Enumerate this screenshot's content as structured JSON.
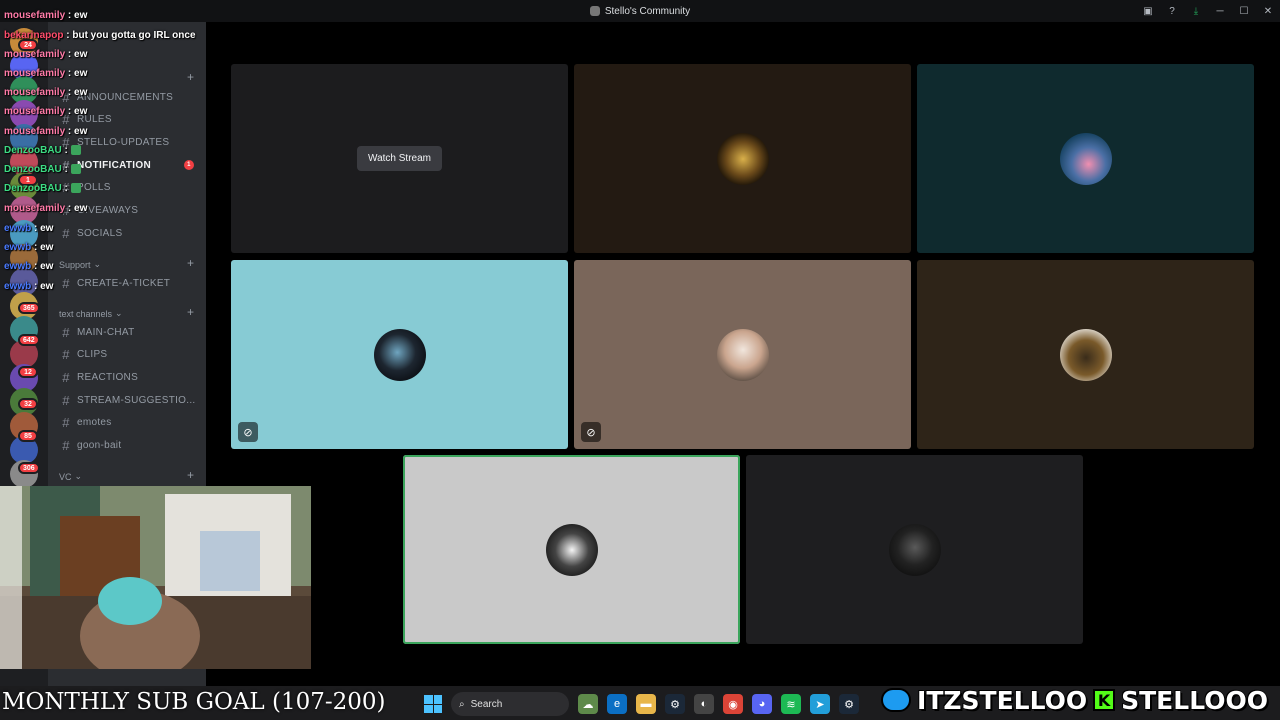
{
  "window": {
    "title": "Stello's Community"
  },
  "sidebar": {
    "channels_top": [
      {
        "name": "ANNOUNCEMENTS"
      },
      {
        "name": "RULES"
      },
      {
        "name": "STELLO-UPDATES"
      },
      {
        "name": "NOTIFICATION",
        "active": true,
        "unread": "1"
      },
      {
        "name": "POLLS"
      },
      {
        "name": "GIVEAWAYS"
      },
      {
        "name": "SOCIALS"
      }
    ],
    "support_category": "Support",
    "support_channels": [
      {
        "name": "CREATE-A-TICKET"
      }
    ],
    "text_category": "text channels",
    "text_channels": [
      {
        "name": "MAIN-CHAT"
      },
      {
        "name": "CLIPS"
      },
      {
        "name": "REACTIONS"
      },
      {
        "name": "STREAM-SUGGESTIO..."
      },
      {
        "name": "emotes"
      },
      {
        "name": "goon-bait"
      }
    ],
    "vc_category": "VC"
  },
  "rail_badges": [
    "24",
    "1",
    "365",
    "642",
    "12",
    "32",
    "85",
    "306"
  ],
  "stage": {
    "watch_stream": "Watch Stream"
  },
  "chat": {
    "messages": [
      {
        "user": "mousefamily",
        "text": "ew",
        "color": "#ff7ba8"
      },
      {
        "user": "bekarinapop",
        "text": "but you gotta go IRL once",
        "color": "#ff4d6d"
      },
      {
        "user": "mousefamily",
        "text": "ew",
        "color": "#ff7ba8"
      },
      {
        "user": "mousefamily",
        "text": "ew",
        "color": "#ff7ba8"
      },
      {
        "user": "mousefamily",
        "text": "ew",
        "color": "#ff7ba8"
      },
      {
        "user": "mousefamily",
        "text": "ew",
        "color": "#ff7ba8"
      },
      {
        "user": "mousefamily",
        "text": "ew",
        "color": "#ff7ba8"
      },
      {
        "user": "DenzooBAU",
        "text": "",
        "color": "#3ddc84"
      },
      {
        "user": "DenzooBAU",
        "text": "",
        "color": "#3ddc84"
      },
      {
        "user": "DenzooBAU",
        "text": "",
        "color": "#3ddc84"
      },
      {
        "user": "mousefamily",
        "text": "ew",
        "color": "#ff7ba8"
      },
      {
        "user": "ewwb",
        "text": "ew",
        "color": "#4a7bff"
      },
      {
        "user": "ewwb",
        "text": "ew",
        "color": "#4a7bff"
      },
      {
        "user": "ewwb",
        "text": "ew",
        "color": "#4a7bff"
      },
      {
        "user": "ewwb",
        "text": "ew",
        "color": "#4a7bff"
      }
    ],
    "separator": " : "
  },
  "overlay": {
    "goal": "MONTHLY SUB GOAL (107-200)",
    "twitter_handle": "ITZSTELLOO",
    "kick_letter": "K",
    "kick_handle": "STELLOOO"
  },
  "taskbar": {
    "search_label": "Search"
  },
  "colors": {
    "tile_light_blue": "#87cbd4",
    "tile_taupe": "#7a665a",
    "tile_dark_brown": "#2e2418",
    "tile_teal": "#0f2a2e",
    "tile_brown": "#231a12",
    "tile_light_grey": "#c9c9c9",
    "speaking_border": "#3ba55c"
  }
}
